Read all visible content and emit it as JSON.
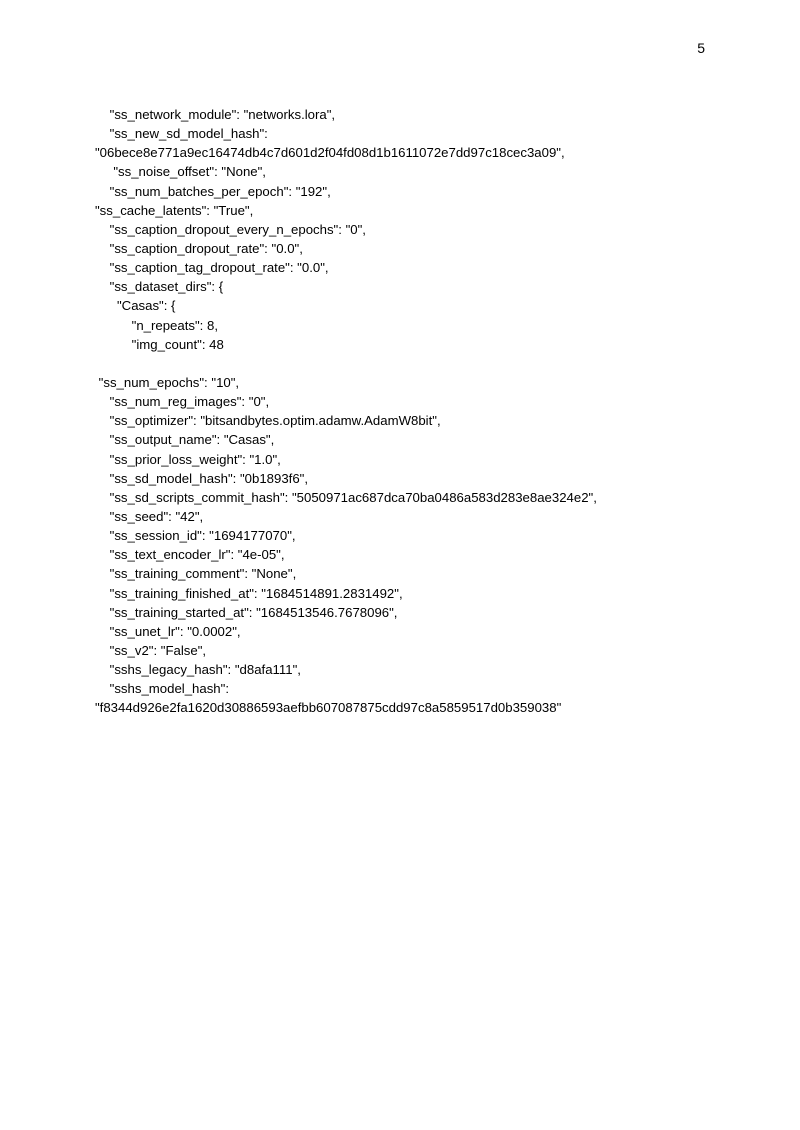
{
  "page_number": "5",
  "lines": [
    {
      "indent": 4,
      "text": "\"ss_network_module\": \"networks.lora\","
    },
    {
      "indent": 4,
      "text": "\"ss_new_sd_model_hash\":"
    },
    {
      "indent": 0,
      "text": "\"06bece8e771a9ec16474db4c7d601d2f04fd08d1b1611072e7dd97c18cec3a09\","
    },
    {
      "indent": 5,
      "text": "\"ss_noise_offset\": \"None\","
    },
    {
      "indent": 4,
      "text": "\"ss_num_batches_per_epoch\": \"192\","
    },
    {
      "indent": 0,
      "text": "\"ss_cache_latents\": \"True\","
    },
    {
      "indent": 4,
      "text": "\"ss_caption_dropout_every_n_epochs\": \"0\","
    },
    {
      "indent": 4,
      "text": "\"ss_caption_dropout_rate\": \"0.0\","
    },
    {
      "indent": 4,
      "text": "\"ss_caption_tag_dropout_rate\": \"0.0\","
    },
    {
      "indent": 4,
      "text": "\"ss_dataset_dirs\": {"
    },
    {
      "indent": 6,
      "text": "\"Casas\": {"
    },
    {
      "indent": 10,
      "text": "\"n_repeats\": 8,"
    },
    {
      "indent": 10,
      "text": "\"img_count\": 48"
    },
    {
      "indent": 0,
      "text": ""
    },
    {
      "indent": 1,
      "text": "\"ss_num_epochs\": \"10\","
    },
    {
      "indent": 4,
      "text": "\"ss_num_reg_images\": \"0\","
    },
    {
      "indent": 4,
      "text": "\"ss_optimizer\": \"bitsandbytes.optim.adamw.AdamW8bit\","
    },
    {
      "indent": 4,
      "text": "\"ss_output_name\": \"Casas\","
    },
    {
      "indent": 4,
      "text": "\"ss_prior_loss_weight\": \"1.0\","
    },
    {
      "indent": 4,
      "text": "\"ss_sd_model_hash\": \"0b1893f6\","
    },
    {
      "indent": 4,
      "text": "\"ss_sd_scripts_commit_hash\": \"5050971ac687dca70ba0486a583d283e8ae324e2\","
    },
    {
      "indent": 4,
      "text": "\"ss_seed\": \"42\","
    },
    {
      "indent": 4,
      "text": "\"ss_session_id\": \"1694177070\","
    },
    {
      "indent": 4,
      "text": "\"ss_text_encoder_lr\": \"4e-05\","
    },
    {
      "indent": 4,
      "text": "\"ss_training_comment\": \"None\","
    },
    {
      "indent": 4,
      "text": "\"ss_training_finished_at\": \"1684514891.2831492\","
    },
    {
      "indent": 4,
      "text": "\"ss_training_started_at\": \"1684513546.7678096\","
    },
    {
      "indent": 4,
      "text": "\"ss_unet_lr\": \"0.0002\","
    },
    {
      "indent": 4,
      "text": "\"ss_v2\": \"False\","
    },
    {
      "indent": 4,
      "text": "\"sshs_legacy_hash\": \"d8afa111\","
    },
    {
      "indent": 4,
      "text": "\"sshs_model_hash\":"
    },
    {
      "indent": 0,
      "text": "\"f8344d926e2fa1620d30886593aefbb607087875cdd97c8a5859517d0b359038\""
    }
  ]
}
